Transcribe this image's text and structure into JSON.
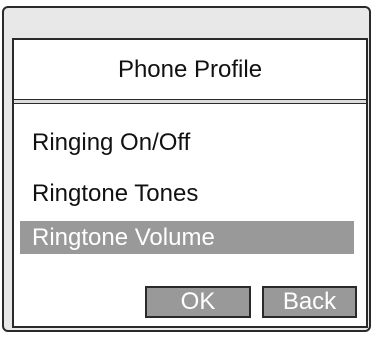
{
  "screen": {
    "title": "Phone Profile",
    "menu": {
      "items": [
        {
          "label": "Ringing On/Off",
          "selected": false
        },
        {
          "label": "Ringtone Tones",
          "selected": false
        },
        {
          "label": "Ringtone Volume",
          "selected": true
        }
      ]
    },
    "softkeys": {
      "ok_label": "OK",
      "back_label": "Back"
    }
  },
  "colors": {
    "selection_bg": "#999999",
    "selection_text": "#ffffff",
    "border": "#2a2a2a",
    "frame_bg": "#e8e8e8"
  }
}
